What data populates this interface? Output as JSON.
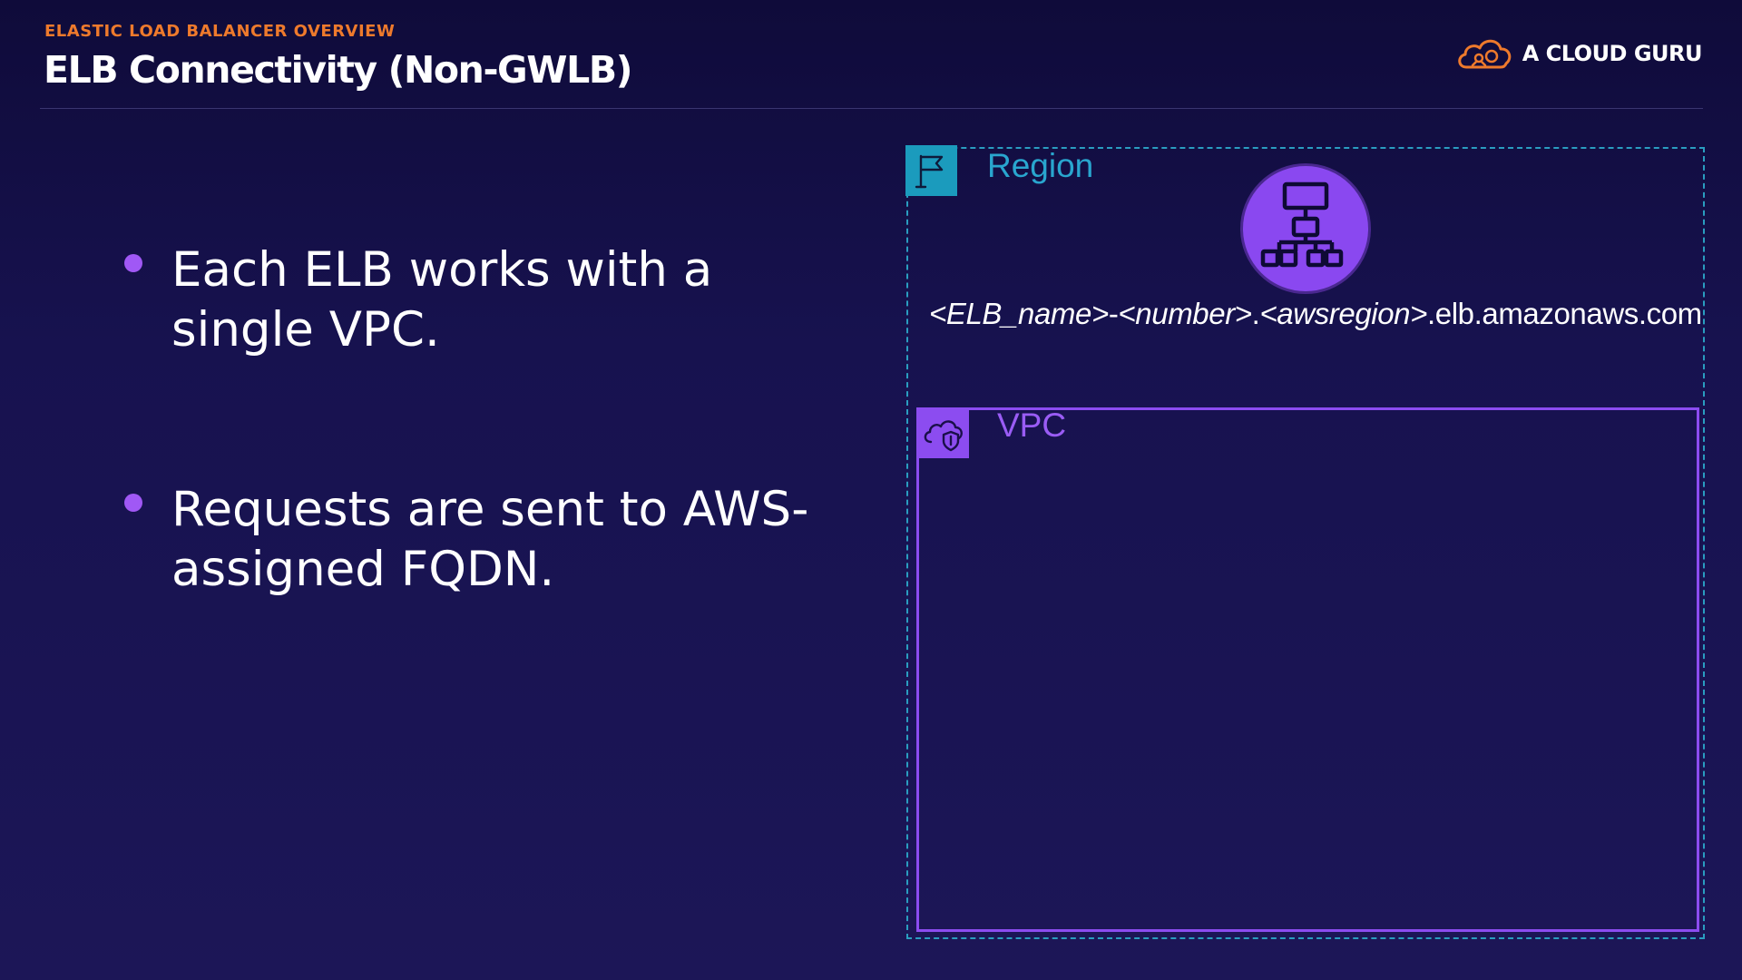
{
  "header": {
    "eyebrow": "ELASTIC LOAD BALANCER OVERVIEW",
    "title": "ELB Connectivity (Non-GWLB)"
  },
  "logo": {
    "text": "A CLOUD GURU",
    "icon": "cloud-logo-icon"
  },
  "bullets": [
    {
      "text": "Each ELB works with a single VPC."
    },
    {
      "text": "Requests are sent to AWS-assigned FQDN."
    }
  ],
  "diagram": {
    "region": {
      "label": "Region",
      "icon": "region-flag-icon"
    },
    "elb": {
      "icon": "load-balancer-icon",
      "fqdn_parts": {
        "p1": "<ELB_name>",
        "s1": "-",
        "p2": "<number>",
        "s2": ".",
        "p3": "<awsregion>",
        "s3": ".elb.amazonaws.com"
      }
    },
    "vpc": {
      "label": "VPC",
      "icon": "vpc-cloud-icon"
    }
  },
  "colors": {
    "accent_orange": "#ee7a2c",
    "accent_purple": "#8c4cf0",
    "region_teal": "#1b9bbd",
    "background": "#17124f"
  }
}
